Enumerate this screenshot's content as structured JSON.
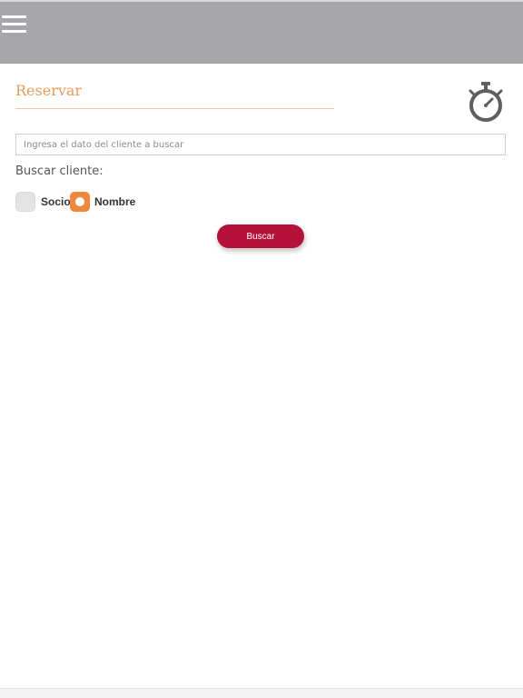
{
  "header": {
    "menu_icon": "hamburger-menu-icon",
    "background_color": "#a7a6ab"
  },
  "main": {
    "title": "Reservar",
    "timer_icon": "stopwatch-icon",
    "search": {
      "value": "",
      "placeholder": "Ingresa el dato del cliente a buscar"
    },
    "search_by_label": "Buscar cliente:",
    "options": [
      {
        "label": "Socio",
        "selected": false
      },
      {
        "label": "Nombre",
        "selected": true
      }
    ],
    "search_button": "Buscar"
  },
  "colors": {
    "accent_orange": "#ef873f",
    "title_orange": "#e89c5b",
    "button_red": "#b5123a"
  }
}
